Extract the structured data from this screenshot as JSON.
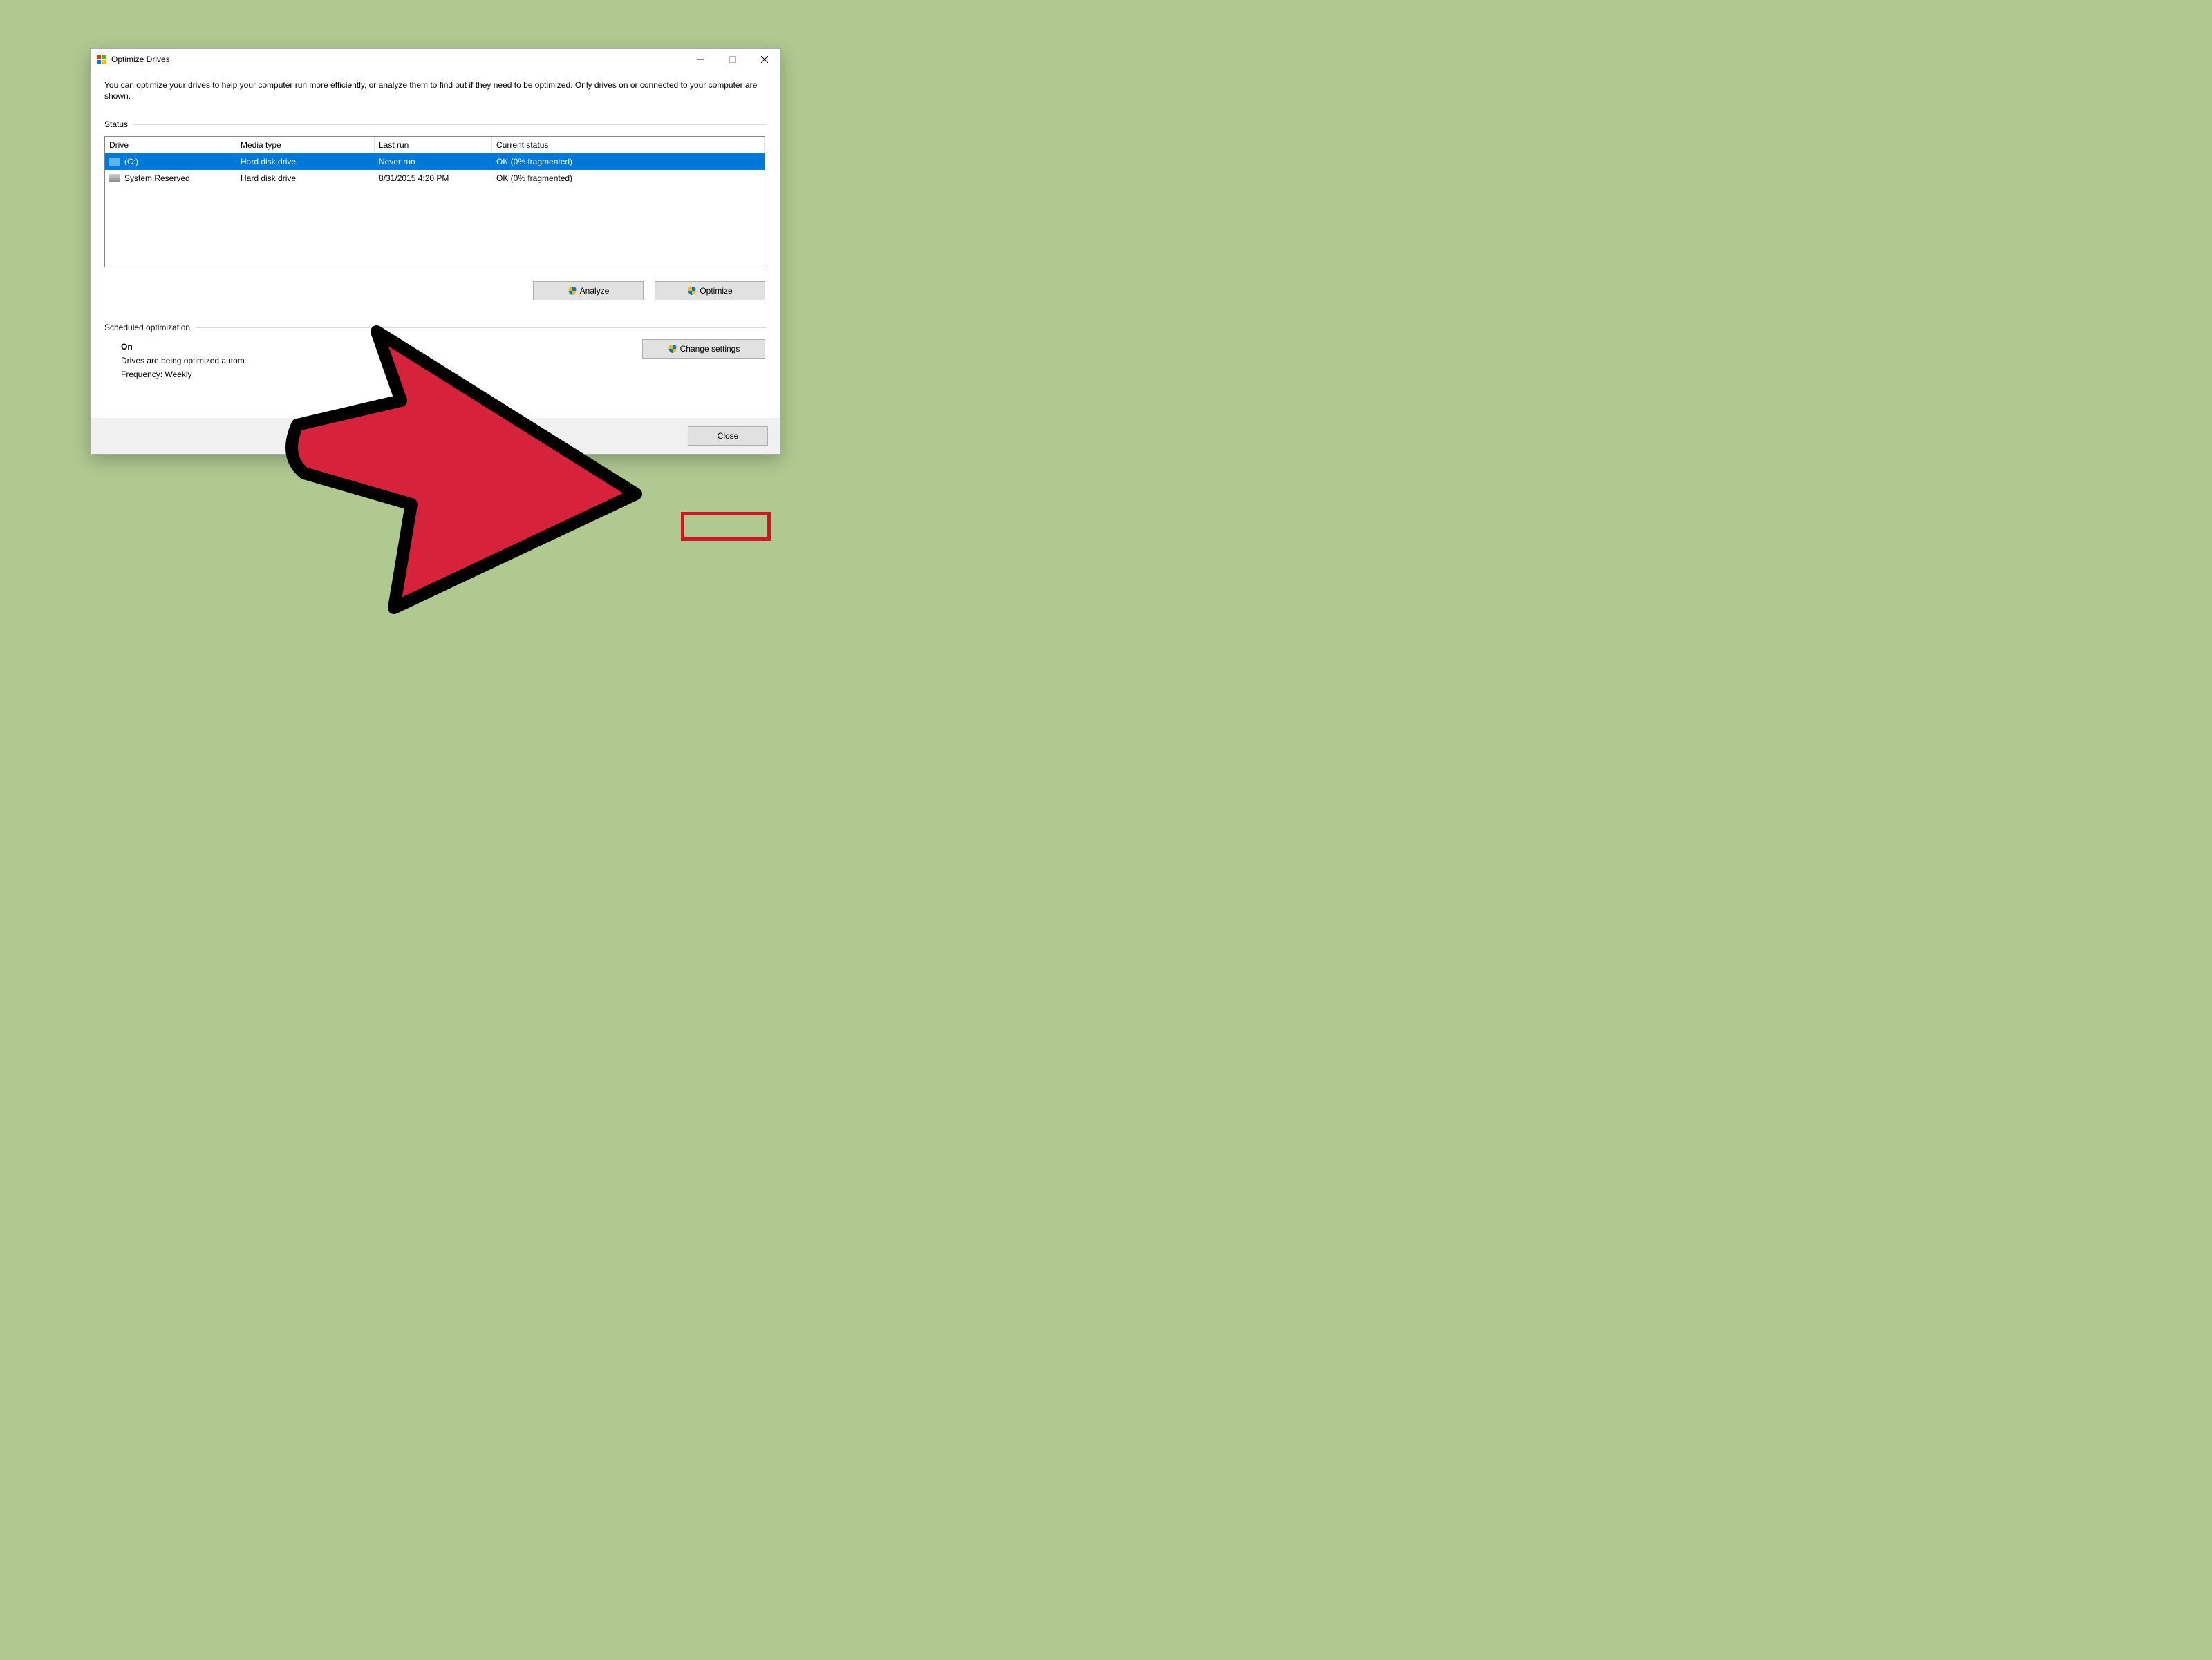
{
  "window": {
    "title": "Optimize Drives",
    "description": "You can optimize your drives to help your computer run more efficiently, or analyze them to find out if they need to be optimized. Only drives on or connected to your computer are shown."
  },
  "status": {
    "section_label": "Status",
    "columns": {
      "drive": "Drive",
      "media": "Media type",
      "last_run": "Last run",
      "current_status": "Current status"
    },
    "rows": [
      {
        "drive": "(C:)",
        "media": "Hard disk drive",
        "last_run": "Never run",
        "current_status": "OK (0% fragmented)",
        "selected": true
      },
      {
        "drive": "System Reserved",
        "media": "Hard disk drive",
        "last_run": "8/31/2015 4:20 PM",
        "current_status": "OK (0% fragmented)",
        "selected": false
      }
    ]
  },
  "actions": {
    "analyze": "Analyze",
    "optimize": "Optimize"
  },
  "schedule": {
    "section_label": "Scheduled optimization",
    "on_label": "On",
    "desc": "Drives are being optimized autom",
    "frequency": "Frequency: Weekly",
    "change_settings": "Change settings"
  },
  "footer": {
    "close": "Close"
  }
}
